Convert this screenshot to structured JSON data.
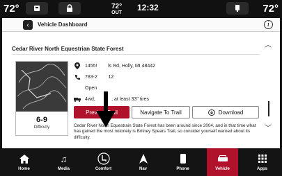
{
  "status": {
    "temp_left": "72°",
    "temp_right": "72°",
    "outside_temp": "72°",
    "outside_label": "OUT",
    "clock": "12:32"
  },
  "header": {
    "breadcrumb": "Vehicle Dashboard"
  },
  "trail": {
    "title": "Cedar River North Equestrian State Forest",
    "address": "1455!        ls Rd, Holly, MI 48442",
    "phone": "783-2        12",
    "hours": "Open",
    "vehicle_req": "4wd,            , at least 33\" tires",
    "difficulty_value": "6-9",
    "difficulty_label": "Difficulty",
    "description": "Cedar River North Equestrain State Forest has been around since 2004, and in that time what has gained the most notoriety is Britney Spears Trail, so consider yourself warned about its difficulty."
  },
  "buttons": {
    "preview": "Preview Trail",
    "navigate": "Navigate To Trail",
    "download": "Download"
  },
  "nav": {
    "items": [
      {
        "label": "Home",
        "icon": "home-icon"
      },
      {
        "label": "Media",
        "icon": "music-note-icon"
      },
      {
        "label": "Comfort",
        "icon": "seat-icon"
      },
      {
        "label": "Nav",
        "icon": "navigation-arrow-icon"
      },
      {
        "label": "Phone",
        "icon": "phone-icon"
      },
      {
        "label": "Vehicle",
        "icon": "vehicle-icon",
        "active": true
      },
      {
        "label": "Apps",
        "icon": "apps-grid-icon"
      }
    ]
  },
  "colors": {
    "accent": "#b0122b",
    "bar": "#141414"
  }
}
